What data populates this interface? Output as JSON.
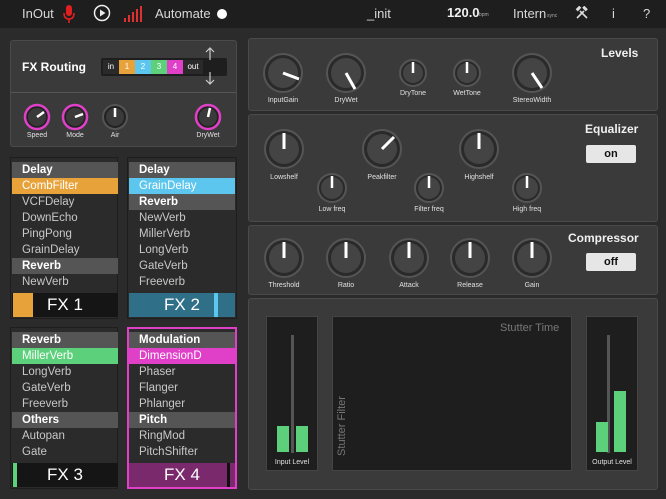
{
  "topbar": {
    "inout": "InOut",
    "automate": "Automate",
    "preset": "_init",
    "tempo": "120.0",
    "tempo_unit": "bpm",
    "sync": "Intern",
    "sync_sub": "sync",
    "info": "i",
    "help": "?"
  },
  "routing": {
    "title": "FX Routing",
    "cells": [
      "in",
      "1",
      "2",
      "3",
      "4",
      "out"
    ],
    "knobs": [
      "Speed",
      "Mode",
      "Air",
      "DryWet"
    ]
  },
  "levels": {
    "title": "Levels",
    "knobs": [
      "InputGain",
      "DryWet",
      "DryTone",
      "WetTone",
      "StereoWidth"
    ]
  },
  "equalizer": {
    "title": "Equalizer",
    "toggle": "on",
    "knobs": [
      "Lowshelf",
      "Peakfilter",
      "Highshelf",
      "Low freq",
      "Filter freq",
      "High freq"
    ]
  },
  "compressor": {
    "title": "Compressor",
    "toggle": "off",
    "knobs": [
      "Threshold",
      "Ratio",
      "Attack",
      "Release",
      "Gain"
    ]
  },
  "stutter": {
    "title": "Stutter Time",
    "side": "Stutter Filter",
    "input_label": "Input Level",
    "output_label": "Output Level"
  },
  "fx1": {
    "footer": "FX 1",
    "rows": [
      "Delay",
      "CombFilter",
      "VCFDelay",
      "DownEcho",
      "PingPong",
      "GrainDelay",
      "Reverb",
      "NewVerb"
    ]
  },
  "fx2": {
    "footer": "FX 2",
    "rows": [
      "Delay",
      "GrainDelay",
      "Reverb",
      "NewVerb",
      "MillerVerb",
      "LongVerb",
      "GateVerb",
      "Freeverb"
    ]
  },
  "fx3": {
    "footer": "FX 3",
    "rows": [
      "Reverb",
      "MillerVerb",
      "LongVerb",
      "GateVerb",
      "Freeverb",
      "Others",
      "Autopan",
      "Gate"
    ]
  },
  "fx4": {
    "footer": "FX 4",
    "rows": [
      "Modulation",
      "DimensionD",
      "Phaser",
      "Flanger",
      "Phlanger",
      "Pitch",
      "RingMod",
      "PitchShifter"
    ]
  },
  "colors": {
    "fx1": "#e8a23a",
    "fx2": "#5cc6ee",
    "fx3": "#5cd07a",
    "fx4": "#e040c8",
    "record": "#e02020"
  }
}
